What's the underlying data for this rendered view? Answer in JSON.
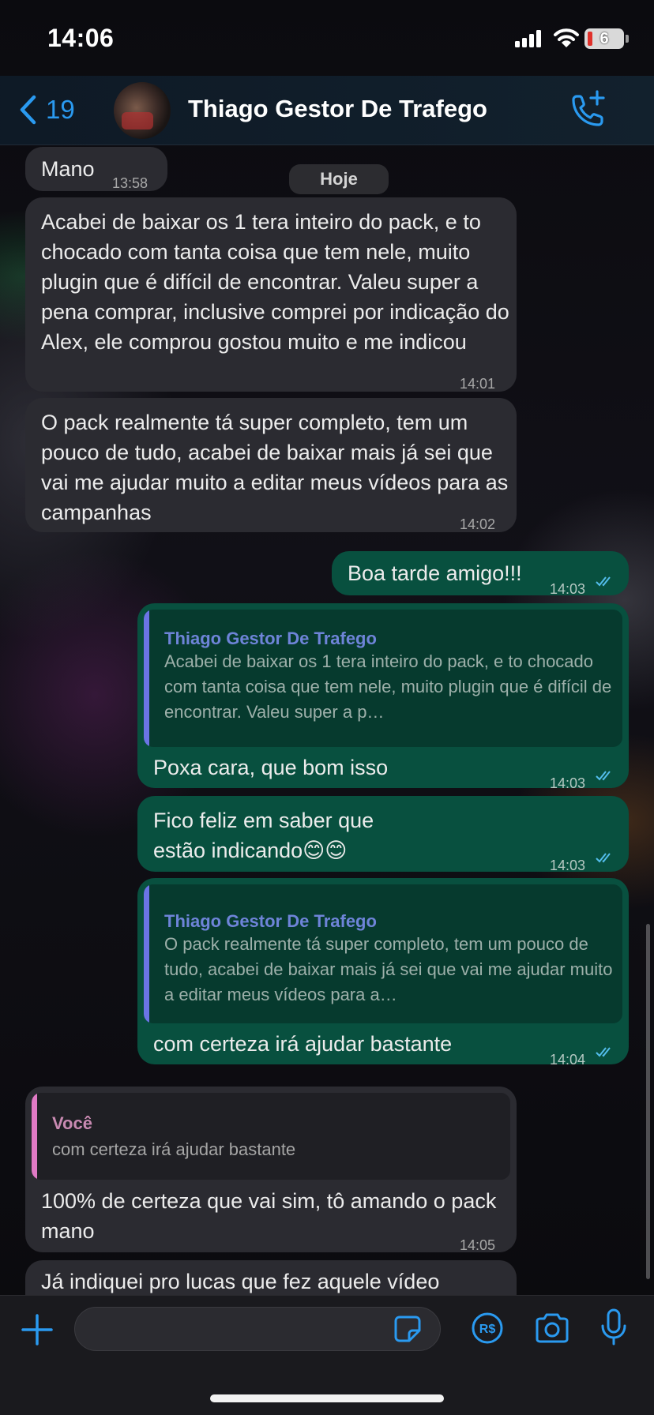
{
  "status_bar": {
    "time": "14:06",
    "battery_level": "6"
  },
  "header": {
    "back_count": "19",
    "title": "Thiago Gestor De Trafego"
  },
  "date_chip": "Hoje",
  "messages": [
    {
      "text": "Mano",
      "time": "13:58"
    },
    {
      "text": "Acabei de baixar os 1 tera inteiro do pack, e to chocado com tanta coisa que tem nele, muito plugin que é difícil de encontrar. Valeu super a pena comprar, inclusive comprei por indicação do Alex, ele comprou gostou muito e me indicou",
      "time": "14:01"
    },
    {
      "text": "O pack realmente tá super completo, tem um pouco de tudo, acabei de baixar mais já sei que vai me ajudar muito a editar meus vídeos para as campanhas",
      "time": "14:02"
    },
    {
      "text": "Boa tarde amigo!!!",
      "time": "14:03"
    },
    {
      "quote_name": "Thiago Gestor De Trafego",
      "quote_text": "Acabei de baixar os 1 tera inteiro do pack, e to chocado com tanta coisa que tem nele, muito plugin que é difícil de encontrar. Valeu super a p…",
      "text": "Poxa cara, que bom isso",
      "time": "14:03"
    },
    {
      "text": "Fico feliz em saber que estão indicando😊😊",
      "time": "14:03"
    },
    {
      "quote_name": "Thiago Gestor De Trafego",
      "quote_text": "O pack realmente tá super completo, tem um pouco de tudo, acabei de baixar mais já sei que vai me ajudar muito a editar meus vídeos para a…",
      "text": "com certeza irá ajudar bastante",
      "time": "14:04"
    },
    {
      "quote_name": "Você",
      "quote_text": "com certeza irá ajudar bastante",
      "text": "100% de certeza que vai sim, tô amando o pack mano",
      "time": "14:05"
    },
    {
      "text": "Já indiquei pro lucas que fez aquele vídeo"
    }
  ],
  "input": {
    "value": ""
  },
  "colors": {
    "accent": "#2a9af0",
    "outgoing_bubble": "#08503f",
    "incoming_bubble": "#2b2b31",
    "read_ticks": "#53bdeb"
  },
  "icons": [
    "back-chevron-icon",
    "avatar",
    "add-call-icon",
    "plus-icon",
    "sticker-icon",
    "payment-icon",
    "camera-icon",
    "mic-icon",
    "signal-icon",
    "wifi-icon",
    "read-ticks-icon"
  ]
}
